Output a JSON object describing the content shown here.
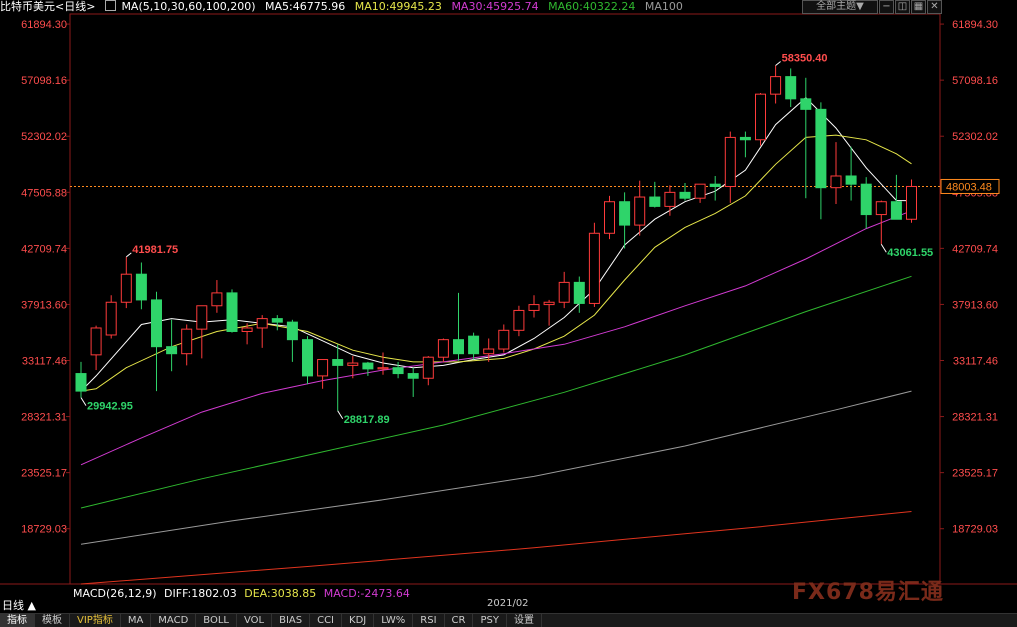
{
  "header": {
    "symbol": "比特币美元<日线>",
    "ma_label": "MA(5,10,30,60,100,200)",
    "ma5": "MA5:46775.96",
    "ma10": "MA10:49945.23",
    "ma30": "MA30:45925.74",
    "ma60": "MA60:40322.24",
    "ma100": "MA100"
  },
  "controls": {
    "theme_button": "全部主题▼"
  },
  "colors": {
    "up": "#ff3b3b",
    "down": "#2fd46a",
    "ma5": "#ffffff",
    "ma10": "#e6e64a",
    "ma30": "#d23bd2",
    "ma60": "#2fb82f",
    "ma100": "#9a9a9a",
    "ma200": "#e0341e",
    "axis_text": "#ff4d4d",
    "current": "#ff8a1e"
  },
  "macd": {
    "label": "MACD(26,12,9)",
    "diff": "DIFF:1802.03",
    "dea": "DEA:3038.85",
    "macd": "MACD:-2473.64"
  },
  "bottom": {
    "period": "日线 ▲",
    "date": "2021/02",
    "tabs": [
      "指标",
      "模板",
      "VIP指标",
      "MA",
      "MACD",
      "BOLL",
      "VOL",
      "BIAS",
      "CCI",
      "KDJ",
      "LW%",
      "RSI",
      "CR",
      "PSY",
      "设置"
    ]
  },
  "watermark": "FX678易汇通",
  "chart_data": {
    "type": "candlestick",
    "title": "比特币美元<日线>",
    "ylim": [
      14000,
      62500
    ],
    "y_ticks": [
      "61894.30",
      "57098.16",
      "52302.02",
      "47505.88",
      "42709.74",
      "37913.60",
      "33117.46",
      "28321.31",
      "23525.17",
      "18729.03"
    ],
    "y_tick_values": [
      61894.3,
      57098.16,
      52302.02,
      47505.88,
      42709.74,
      37913.6,
      33117.46,
      28321.31,
      23525.17,
      18729.03
    ],
    "x_label": "2021/02",
    "current_price": 48003.48,
    "current_price_label": "48003.48",
    "annotations": [
      {
        "text": "41981.75",
        "value": 41981.75,
        "index": 3,
        "type": "high"
      },
      {
        "text": "29942.95",
        "value": 29942.95,
        "index": 0,
        "type": "low"
      },
      {
        "text": "28817.89",
        "value": 28817.89,
        "index": 17,
        "type": "low"
      },
      {
        "text": "58350.40",
        "value": 58350.4,
        "index": 46,
        "type": "high"
      },
      {
        "text": "43061.55",
        "value": 43061.55,
        "index": 53,
        "type": "low"
      }
    ],
    "candles": [
      [
        32000,
        33000,
        29942.95,
        30500
      ],
      [
        33600,
        36100,
        32300,
        35900
      ],
      [
        35300,
        38700,
        35000,
        38100
      ],
      [
        38100,
        41981.75,
        37600,
        40500
      ],
      [
        40500,
        41500,
        37500,
        38300
      ],
      [
        38300,
        39000,
        30500,
        34300
      ],
      [
        34300,
        36600,
        32200,
        33700
      ],
      [
        33700,
        36200,
        32700,
        35800
      ],
      [
        35800,
        36500,
        33300,
        37800
      ],
      [
        37800,
        40000,
        37200,
        38900
      ],
      [
        38900,
        39200,
        35500,
        35600
      ],
      [
        35600,
        36300,
        34500,
        35900
      ],
      [
        35900,
        37000,
        34200,
        36700
      ],
      [
        36700,
        37000,
        35700,
        36400
      ],
      [
        36400,
        36600,
        33000,
        34900
      ],
      [
        34900,
        35200,
        31100,
        31800
      ],
      [
        31800,
        33200,
        30700,
        33200
      ],
      [
        33200,
        34500,
        28817.89,
        32700
      ],
      [
        32700,
        33500,
        31600,
        32900
      ],
      [
        32900,
        33000,
        31800,
        32400
      ],
      [
        32400,
        33800,
        31900,
        32500
      ],
      [
        32500,
        33000,
        31600,
        32000
      ],
      [
        32000,
        32500,
        30000,
        31600
      ],
      [
        31600,
        33500,
        31000,
        33400
      ],
      [
        33400,
        35000,
        33000,
        34900
      ],
      [
        34900,
        38900,
        33100,
        33700
      ],
      [
        35200,
        35500,
        33200,
        33700
      ],
      [
        33700,
        35000,
        33000,
        34100
      ],
      [
        34100,
        36200,
        33800,
        35700
      ],
      [
        35700,
        37800,
        35200,
        37400
      ],
      [
        37400,
        38700,
        36800,
        37900
      ],
      [
        37900,
        38300,
        36100,
        38100
      ],
      [
        38100,
        40700,
        37600,
        39800
      ],
      [
        39800,
        40300,
        37200,
        38000
      ],
      [
        38000,
        44900,
        37700,
        44000
      ],
      [
        44000,
        47200,
        43500,
        46700
      ],
      [
        46700,
        47500,
        42700,
        44700
      ],
      [
        44700,
        48500,
        43800,
        47100
      ],
      [
        47100,
        48400,
        46200,
        46300
      ],
      [
        46300,
        48100,
        45500,
        47500
      ],
      [
        47500,
        48300,
        46800,
        47000
      ],
      [
        47000,
        48000,
        46600,
        48200
      ],
      [
        48200,
        48900,
        46800,
        48000
      ],
      [
        48000,
        52700,
        46600,
        52200
      ],
      [
        52200,
        52700,
        50500,
        52000
      ],
      [
        52000,
        56000,
        51500,
        55900
      ],
      [
        55900,
        58350.4,
        55100,
        57400
      ],
      [
        57400,
        58100,
        54800,
        55500
      ],
      [
        55500,
        57300,
        47000,
        54600
      ],
      [
        54600,
        55200,
        45200,
        47900
      ],
      [
        47900,
        51800,
        46500,
        48900
      ],
      [
        48900,
        51400,
        46800,
        48200
      ],
      [
        48200,
        48800,
        44400,
        45600
      ],
      [
        45600,
        46800,
        43061.55,
        46700
      ],
      [
        46700,
        49000,
        45500,
        45200
      ],
      [
        45200,
        48600,
        44900,
        48003.48
      ]
    ],
    "series": [
      {
        "key": "ma5",
        "points": [
          [
            0,
            30500
          ],
          [
            1,
            31800
          ],
          [
            4,
            36200
          ],
          [
            6,
            36700
          ],
          [
            8,
            36400
          ],
          [
            10,
            36600
          ],
          [
            12,
            36300
          ],
          [
            14,
            36000
          ],
          [
            16,
            34800
          ],
          [
            18,
            33600
          ],
          [
            20,
            32900
          ],
          [
            22,
            32500
          ],
          [
            24,
            32700
          ],
          [
            26,
            33200
          ],
          [
            28,
            33600
          ],
          [
            30,
            35000
          ],
          [
            32,
            36800
          ],
          [
            34,
            39200
          ],
          [
            36,
            43000
          ],
          [
            38,
            45200
          ],
          [
            40,
            46700
          ],
          [
            42,
            47600
          ],
          [
            44,
            49400
          ],
          [
            46,
            53300
          ],
          [
            48,
            55600
          ],
          [
            50,
            53000
          ],
          [
            52,
            49600
          ],
          [
            54,
            46800
          ],
          [
            55,
            46776
          ]
        ]
      },
      {
        "key": "ma10",
        "points": [
          [
            0,
            30500
          ],
          [
            1,
            30700
          ],
          [
            3,
            32500
          ],
          [
            6,
            34300
          ],
          [
            9,
            35600
          ],
          [
            12,
            36300
          ],
          [
            15,
            35600
          ],
          [
            18,
            34000
          ],
          [
            20,
            33400
          ],
          [
            22,
            33000
          ],
          [
            25,
            33000
          ],
          [
            28,
            33300
          ],
          [
            30,
            34100
          ],
          [
            32,
            35200
          ],
          [
            34,
            37000
          ],
          [
            36,
            40000
          ],
          [
            38,
            42800
          ],
          [
            40,
            44500
          ],
          [
            42,
            45700
          ],
          [
            44,
            47200
          ],
          [
            46,
            49900
          ],
          [
            48,
            52200
          ],
          [
            50,
            52400
          ],
          [
            52,
            52000
          ],
          [
            54,
            50800
          ],
          [
            55,
            49945
          ]
        ]
      },
      {
        "key": "ma30",
        "points": [
          [
            0,
            24200
          ],
          [
            4,
            26500
          ],
          [
            8,
            28700
          ],
          [
            12,
            30300
          ],
          [
            16,
            31400
          ],
          [
            20,
            32300
          ],
          [
            24,
            33000
          ],
          [
            28,
            33700
          ],
          [
            32,
            34500
          ],
          [
            36,
            36000
          ],
          [
            40,
            37800
          ],
          [
            44,
            39500
          ],
          [
            48,
            41800
          ],
          [
            52,
            44400
          ],
          [
            55,
            45926
          ]
        ]
      },
      {
        "key": "ma60",
        "points": [
          [
            0,
            20500
          ],
          [
            8,
            23000
          ],
          [
            16,
            25300
          ],
          [
            24,
            27600
          ],
          [
            32,
            30400
          ],
          [
            40,
            33600
          ],
          [
            48,
            37300
          ],
          [
            55,
            40322
          ]
        ]
      },
      {
        "key": "ma100",
        "points": [
          [
            0,
            17400
          ],
          [
            10,
            19400
          ],
          [
            20,
            21200
          ],
          [
            30,
            23200
          ],
          [
            40,
            25800
          ],
          [
            50,
            28900
          ],
          [
            55,
            30500
          ]
        ]
      },
      {
        "key": "ma200",
        "points": [
          [
            0,
            14000
          ],
          [
            15,
            15500
          ],
          [
            30,
            17100
          ],
          [
            45,
            18900
          ],
          [
            55,
            20200
          ]
        ]
      }
    ]
  }
}
